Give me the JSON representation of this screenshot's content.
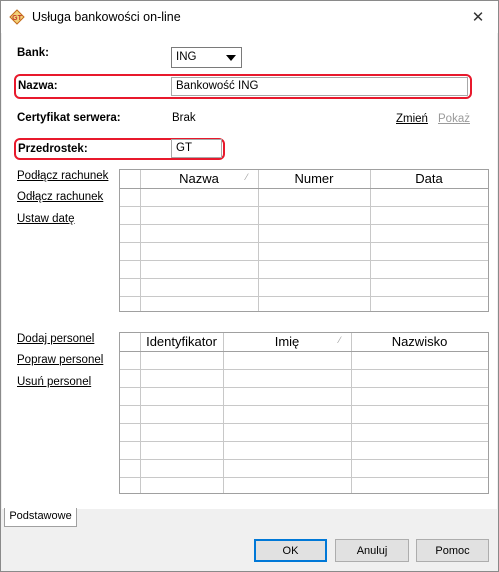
{
  "window": {
    "title": "Usługa bankowości on-line",
    "close_glyph": "✕",
    "icon": "gt-app-icon"
  },
  "form": {
    "bank_label": "Bank:",
    "bank_value": "ING",
    "name_label": "Nazwa:",
    "name_value": "Bankowość ING",
    "cert_label": "Certyfikat serwera:",
    "cert_value": "Brak",
    "cert_change": "Zmień",
    "cert_show": "Pokaż",
    "prefix_label": "Przedrostek:",
    "prefix_value": "GT"
  },
  "accounts": {
    "actions": [
      "Podłącz rachunek",
      "Odłącz rachunek",
      "Ustaw datę"
    ],
    "columns": [
      "Nazwa",
      "Numer",
      "Data"
    ]
  },
  "personnel": {
    "actions": [
      "Dodaj personel",
      "Popraw personel",
      "Usuń personel"
    ],
    "columns": [
      "Identyfikator",
      "Imię",
      "Nazwisko"
    ]
  },
  "tabs": [
    "Podstawowe"
  ],
  "buttons": {
    "ok": "OK",
    "cancel": "Anuluj",
    "help": "Pomoc"
  },
  "colors": {
    "highlight": "#e8192c",
    "default_button_border": "#0078d7"
  }
}
